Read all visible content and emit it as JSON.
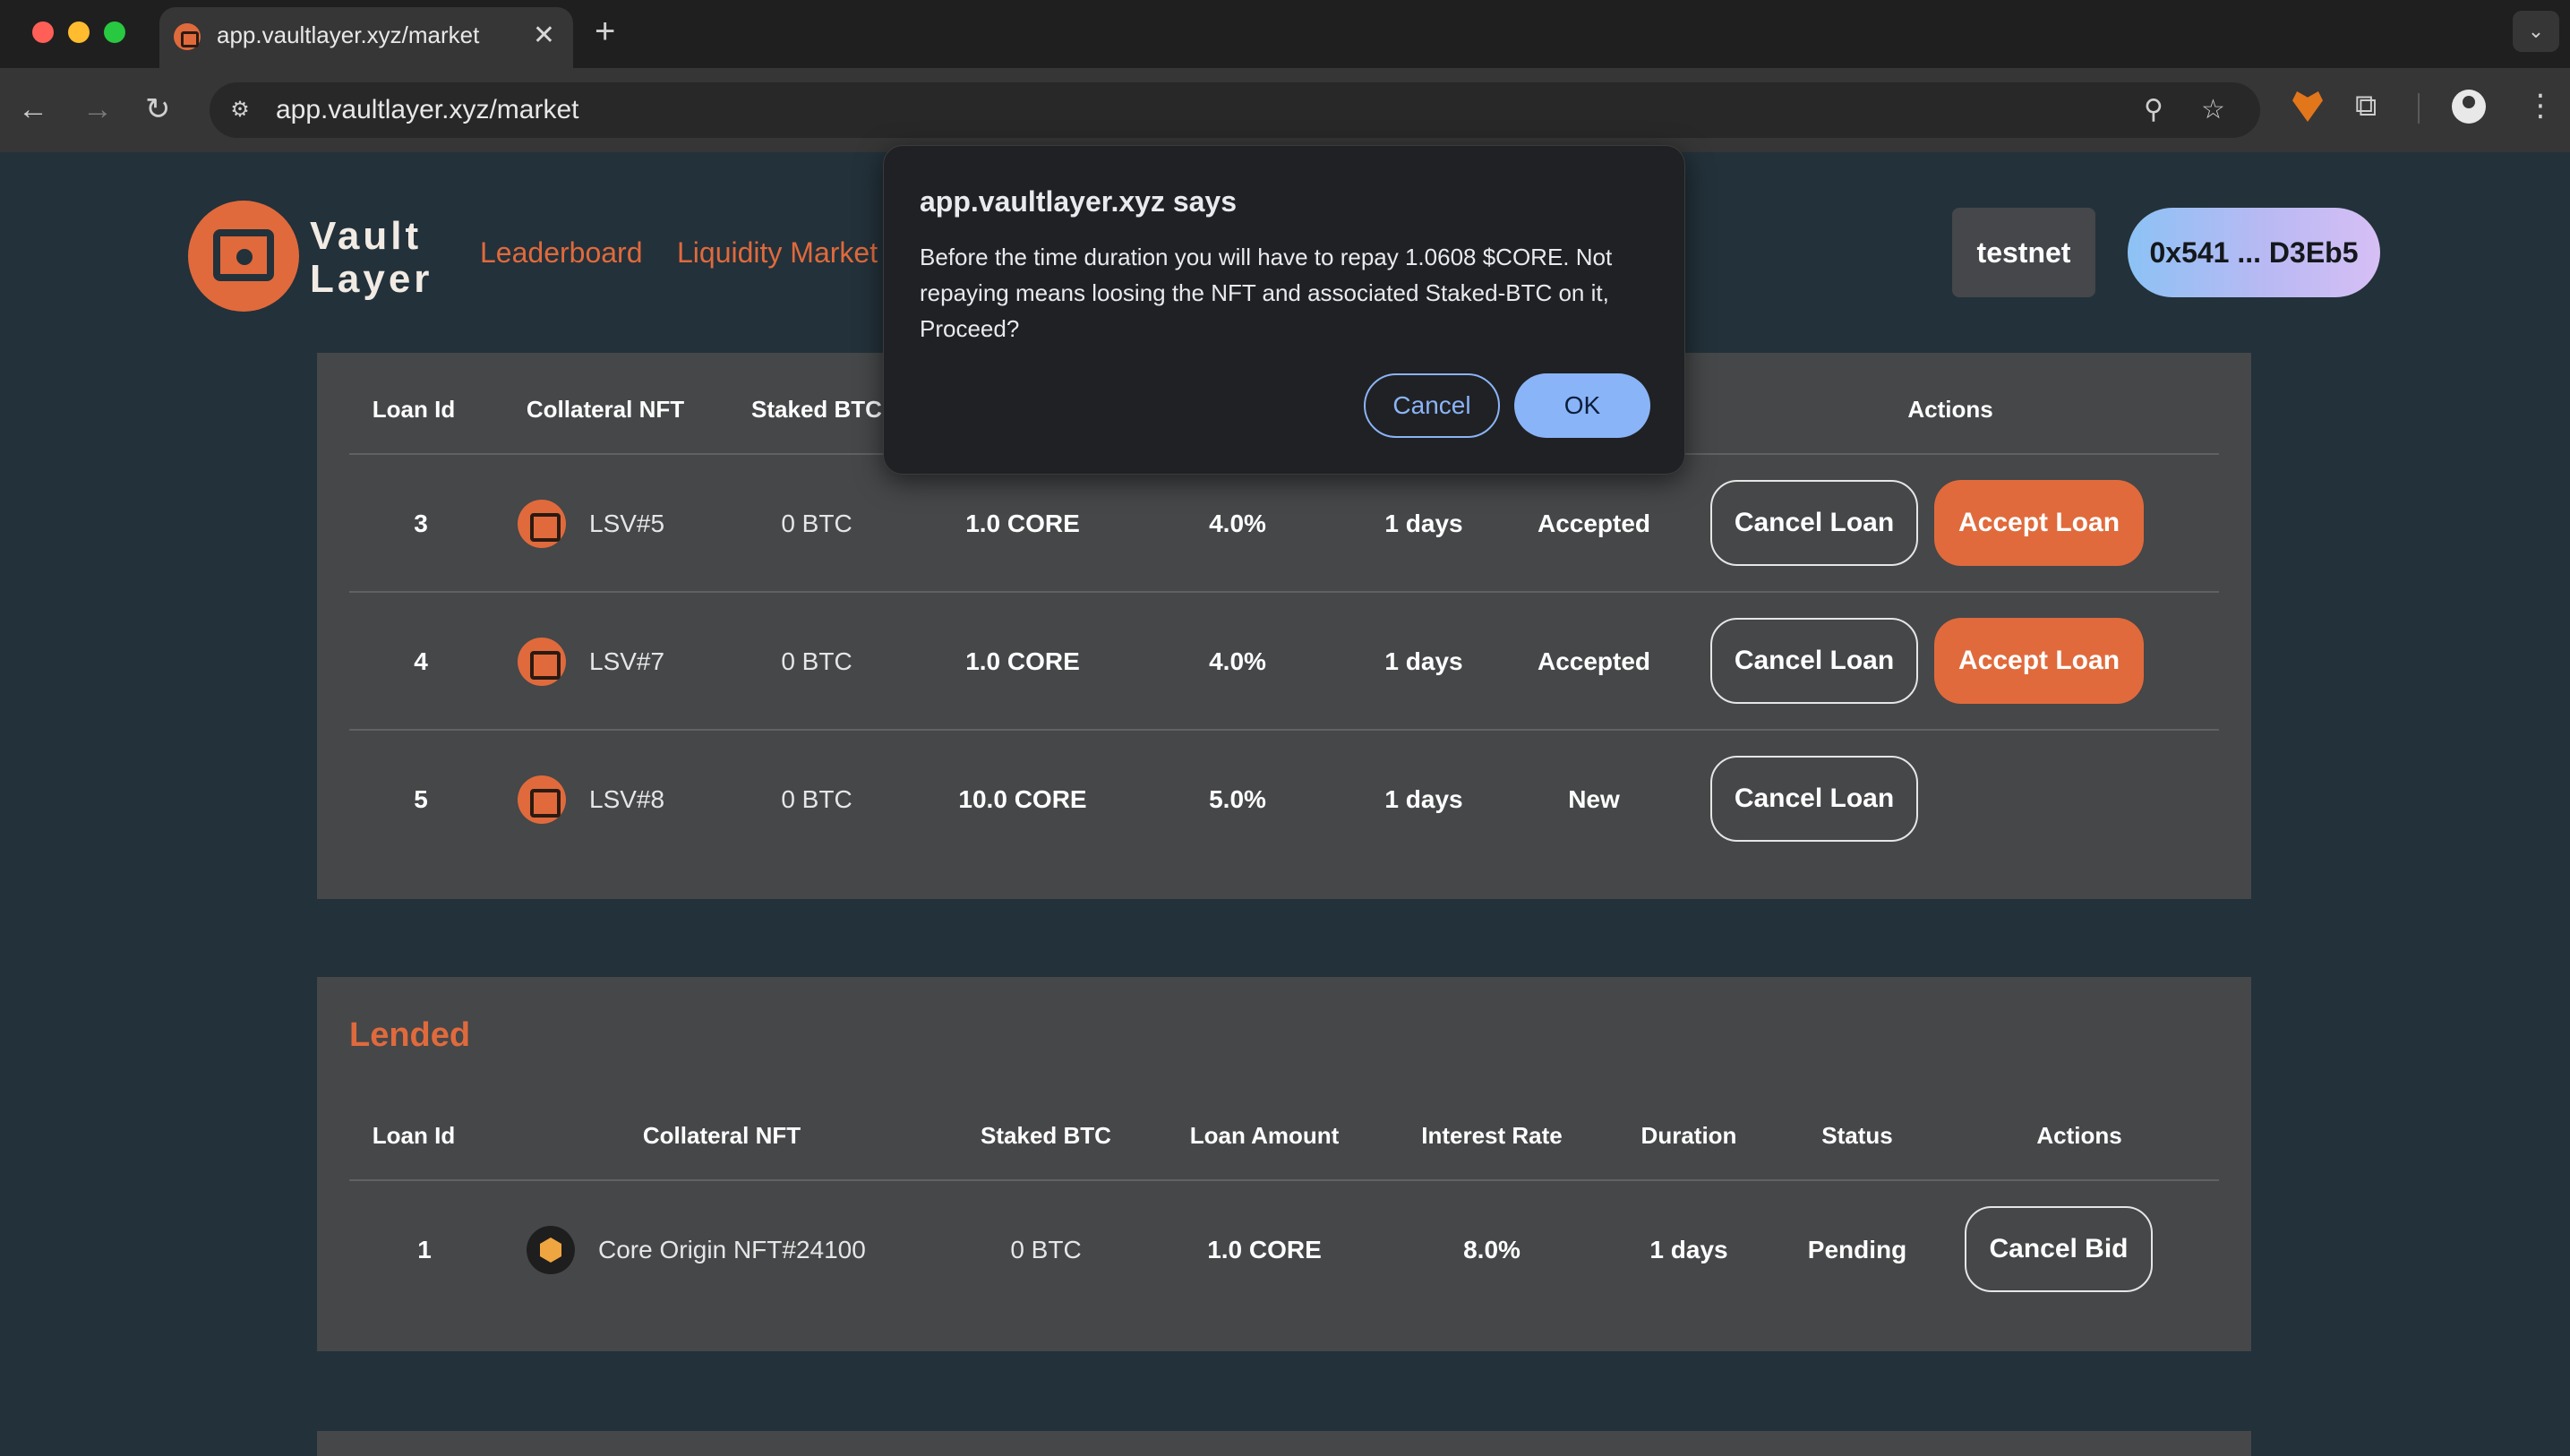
{
  "browser": {
    "tab_title": "app.vaultlayer.xyz/market",
    "tab_close": "✕",
    "new_tab": "+",
    "tab_menu": "⌄",
    "url": "app.vaultlayer.xyz/market",
    "back": "←",
    "forward": "→",
    "reload": "↻",
    "zoom": "⚲",
    "star": "☆",
    "puzzle": "⧉",
    "kebab": "⋮",
    "site_info": "⚙",
    "icons": [
      "back-icon",
      "forward-icon",
      "reload-icon",
      "site-info-icon",
      "zoom-icon",
      "star-icon",
      "metamask-icon",
      "extensions-icon",
      "profile-icon",
      "menu-icon"
    ]
  },
  "header": {
    "logo_line1": "Vault",
    "logo_line2": "Layer",
    "nav": [
      "Leaderboard",
      "Liquidity Market"
    ],
    "network": "testnet",
    "wallet": "0x541 ... D3Eb5"
  },
  "borrowed": {
    "headers": [
      "Loan Id",
      "Collateral NFT",
      "Staked BTC",
      "Actions"
    ],
    "rows": [
      {
        "id": "3",
        "nft": "LSV#5",
        "staked": "0 BTC",
        "amount": "1.0 CORE",
        "rate": "4.0%",
        "duration": "1 days",
        "status": "Accepted",
        "cancel": "Cancel Loan",
        "accept": "Accept Loan"
      },
      {
        "id": "4",
        "nft": "LSV#7",
        "staked": "0 BTC",
        "amount": "1.0 CORE",
        "rate": "4.0%",
        "duration": "1 days",
        "status": "Accepted",
        "cancel": "Cancel Loan",
        "accept": "Accept Loan"
      },
      {
        "id": "5",
        "nft": "LSV#8",
        "staked": "0 BTC",
        "amount": "10.0 CORE",
        "rate": "5.0%",
        "duration": "1 days",
        "status": "New",
        "cancel": "Cancel Loan"
      }
    ]
  },
  "lended": {
    "title": "Lended",
    "headers": [
      "Loan Id",
      "Collateral NFT",
      "Staked BTC",
      "Loan Amount",
      "Interest Rate",
      "Duration",
      "Status",
      "Actions"
    ],
    "rows": [
      {
        "id": "1",
        "nft": "Core Origin NFT#24100",
        "staked": "0 BTC",
        "amount": "1.0 CORE",
        "rate": "8.0%",
        "duration": "1 days",
        "status": "Pending",
        "cancel": "Cancel Bid"
      }
    ]
  },
  "dialog": {
    "title": "app.vaultlayer.xyz says",
    "message": "Before the time duration you will have to repay 1.0608 $CORE. Not repaying means loosing the NFT and associated Staked-BTC on it, Proceed?",
    "cancel": "Cancel",
    "ok": "OK"
  },
  "colors": {
    "accent": "#e06a3c",
    "page_bg": "#23313a",
    "panel_bg": "#454749",
    "dialog_button": "#8ab4f8"
  }
}
